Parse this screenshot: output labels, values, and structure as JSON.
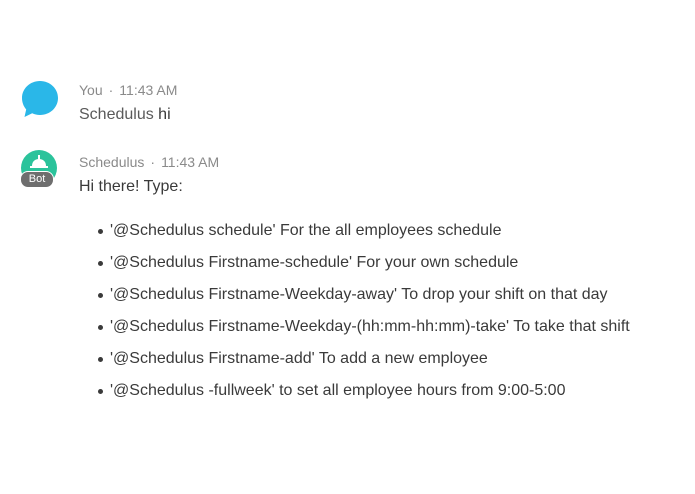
{
  "colors": {
    "user_avatar": "#2ab7e8",
    "bot_avatar": "#2bc39b",
    "bot_badge": "#6e6e6e"
  },
  "messages": [
    {
      "sender": "You",
      "separator": "·",
      "time": "11:43 AM",
      "mention": "Schedulus",
      "text": " hi",
      "avatar_icon": "chat-bubble-icon"
    },
    {
      "sender": "Schedulus",
      "separator": "·",
      "time": "11:43 AM",
      "badge": "Bot",
      "intro": "Hi there! Type:",
      "avatar_icon": "bot-logo-icon",
      "commands": [
        "'@Schedulus schedule' For the all employees schedule",
        "'@Schedulus Firstname-schedule' For your own schedule",
        "'@Schedulus Firstname-Weekday-away' To drop your shift on that day",
        "'@Schedulus Firstname-Weekday-(hh:mm-hh:mm)-take' To take that shift",
        "'@Schedulus Firstname-add' To add a new employee",
        "'@Schedulus -fullweek' to set all employee hours from 9:00-5:00"
      ]
    }
  ]
}
